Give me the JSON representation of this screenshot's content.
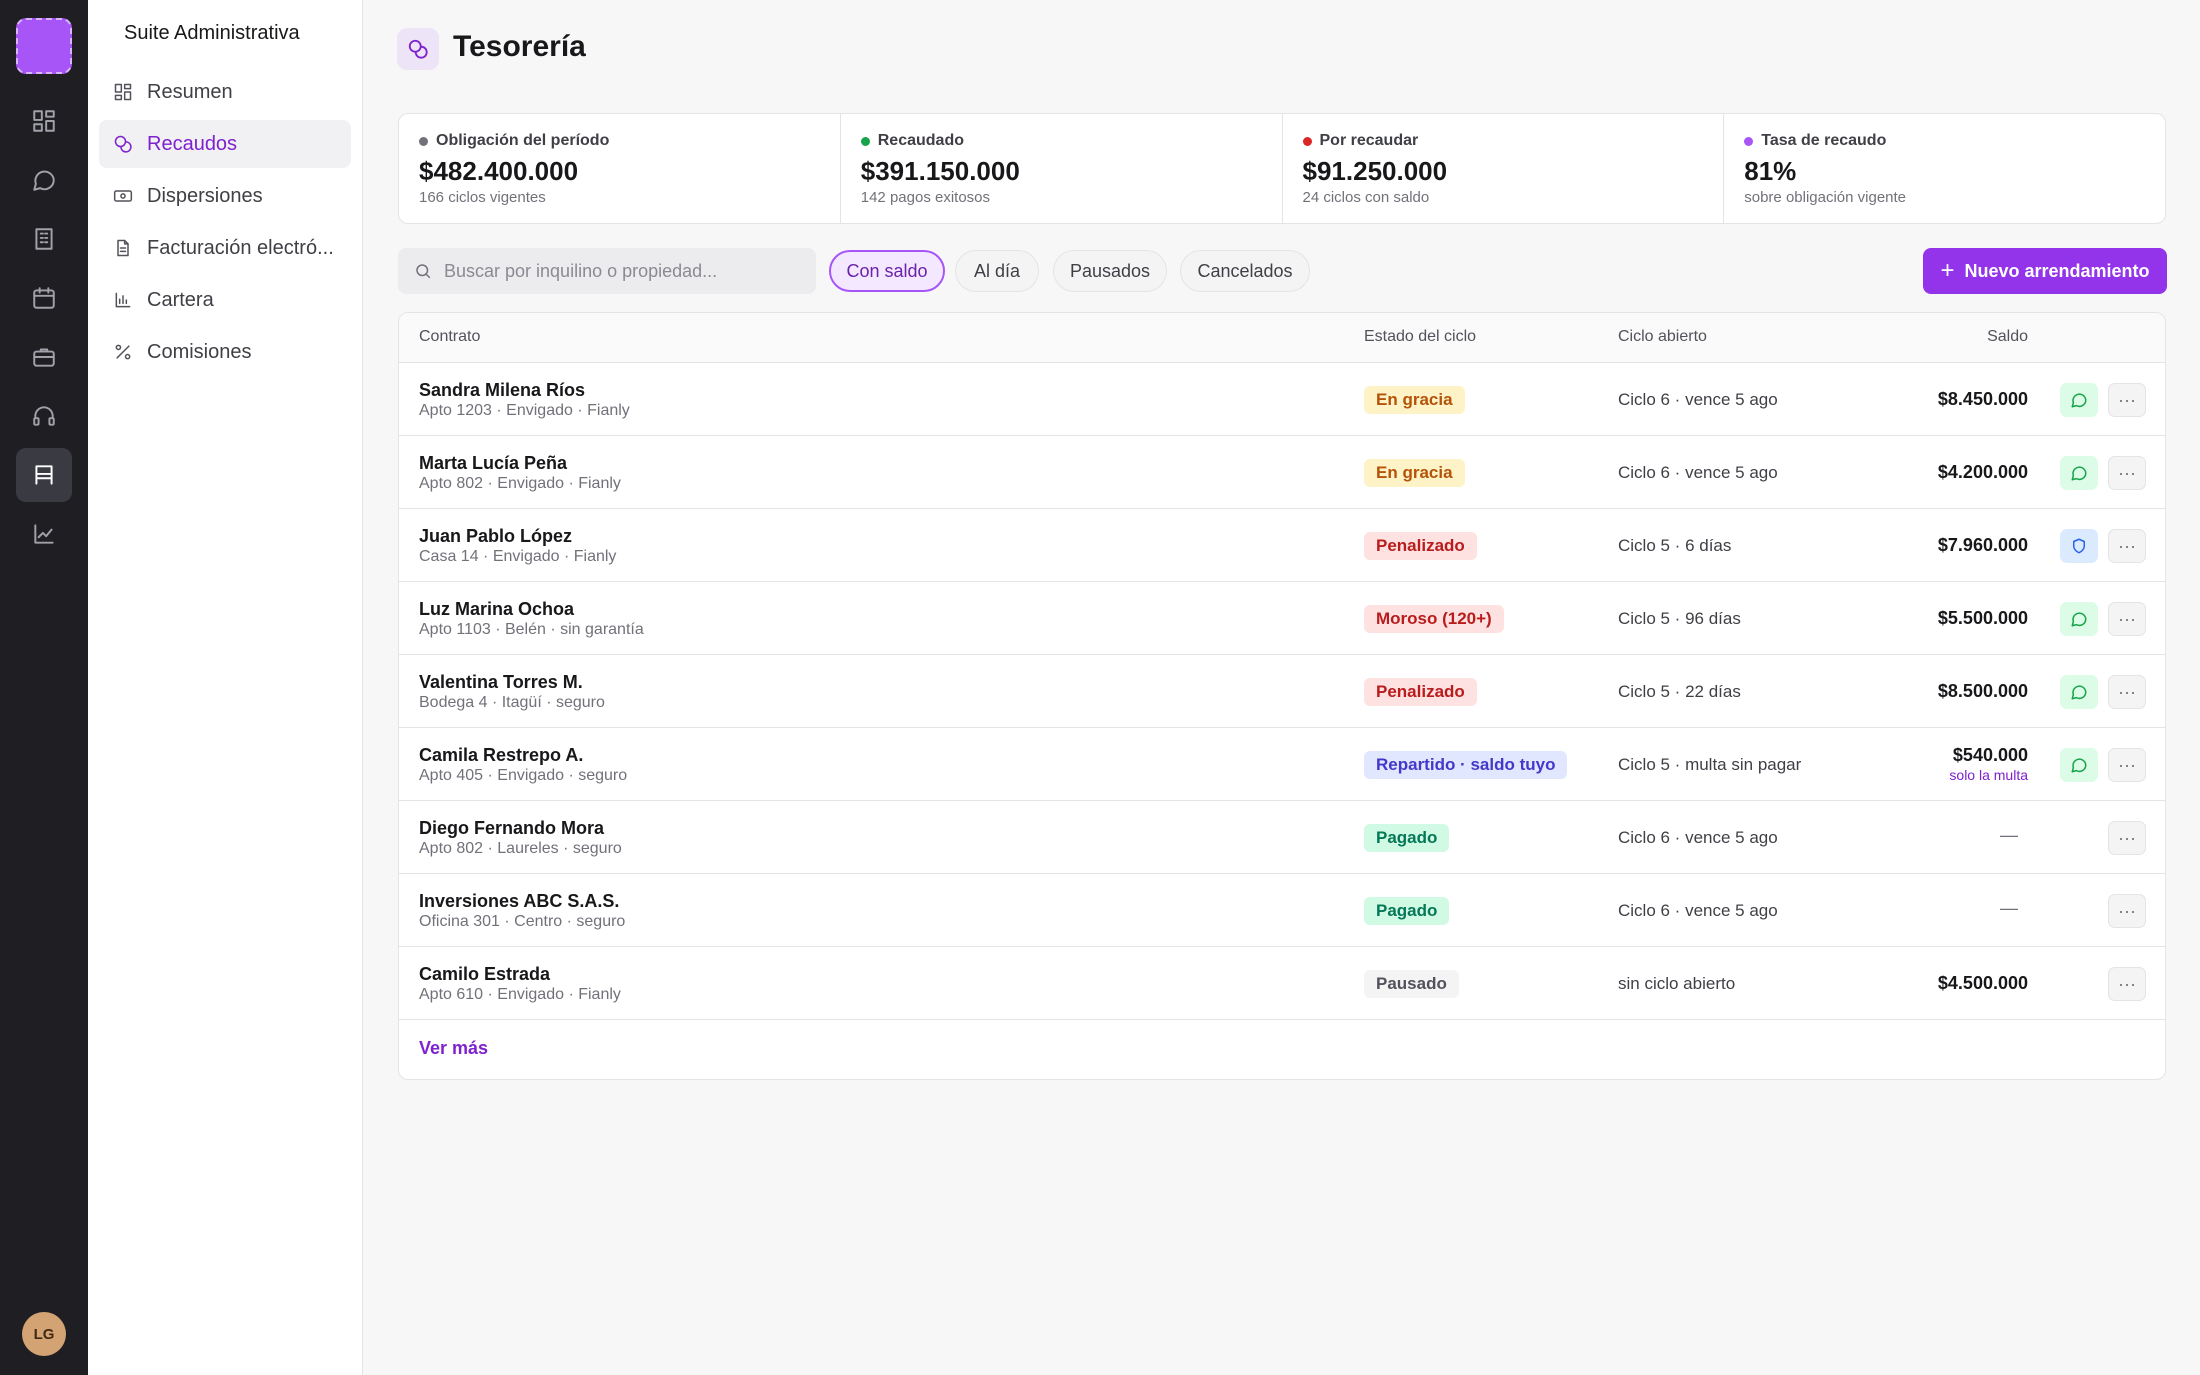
{
  "sidebar": {
    "suite_title": "Suite Administrativa",
    "items": [
      {
        "label": "Resumen",
        "icon": "layout-icon"
      },
      {
        "label": "Recaudos",
        "icon": "coins-icon",
        "active": true
      },
      {
        "label": "Dispersiones",
        "icon": "banknote-icon"
      },
      {
        "label": "Facturación electró...",
        "icon": "document-icon"
      },
      {
        "label": "Cartera",
        "icon": "bar-chart-icon"
      },
      {
        "label": "Comisiones",
        "icon": "percent-icon"
      }
    ]
  },
  "rail": {
    "icons": [
      "dashboard-icon",
      "chat-icon",
      "building-icon",
      "calendar-icon",
      "briefcase-icon",
      "headset-icon",
      "store-icon",
      "chart-line-icon"
    ],
    "active": "store-icon",
    "avatar_initials": "LG"
  },
  "header": {
    "title": "Tesorería"
  },
  "kpis": [
    {
      "label": "Obligación del período",
      "value": "$482.400.000",
      "sub": "166 ciclos vigentes",
      "dot_color": "#71717a"
    },
    {
      "label": "Recaudado",
      "value": "$391.150.000",
      "sub": "142 pagos exitosos",
      "dot_color": "#16a34a"
    },
    {
      "label": "Por recaudar",
      "value": "$91.250.000",
      "sub": "24 ciclos con saldo",
      "dot_color": "#dc2626"
    },
    {
      "label": "Tasa de recaudo",
      "value": "81%",
      "sub": "sobre obligación vigente",
      "dot_color": "#a855f7"
    }
  ],
  "search": {
    "placeholder": "Buscar por inquilino o propiedad...",
    "value": ""
  },
  "filters": [
    {
      "label": "Con saldo",
      "active": true
    },
    {
      "label": "Al día"
    },
    {
      "label": "Pausados"
    },
    {
      "label": "Cancelados"
    }
  ],
  "new_button": {
    "label": "Nuevo arrendamiento"
  },
  "table": {
    "columns": {
      "contrato": "Contrato",
      "estado": "Estado del ciclo",
      "ciclo": "Ciclo abierto",
      "saldo": "Saldo"
    },
    "rows": [
      {
        "name": "Sandra Milena Ríos",
        "meta": "Apto 1203 · Envigado · Fianly",
        "estado": "En gracia",
        "tone": "warn",
        "ciclo": "Ciclo 6 · vence 5 ago",
        "saldo": "$8.450.000",
        "action": "chat"
      },
      {
        "name": "Marta Lucía Peña",
        "meta": "Apto 802 · Envigado · Fianly",
        "estado": "En gracia",
        "tone": "warn",
        "ciclo": "Ciclo 6 · vence 5 ago",
        "saldo": "$4.200.000",
        "action": "chat"
      },
      {
        "name": "Juan Pablo López",
        "meta": "Casa 14 · Envigado · Fianly",
        "estado": "Penalizado",
        "tone": "danger",
        "ciclo": "Ciclo 5 · 6 días",
        "saldo": "$7.960.000",
        "action": "shield"
      },
      {
        "name": "Luz Marina Ochoa",
        "meta": "Apto 1103 · Belén · sin garantía",
        "estado": "Moroso (120+)",
        "tone": "danger",
        "ciclo": "Ciclo 5 · 96 días",
        "saldo": "$5.500.000",
        "action": "chat"
      },
      {
        "name": "Valentina Torres M.",
        "meta": "Bodega 4 · Itagüí · seguro",
        "estado": "Penalizado",
        "tone": "danger",
        "ciclo": "Ciclo 5 · 22 días",
        "saldo": "$8.500.000",
        "action": "chat"
      },
      {
        "name": "Camila Restrepo A.",
        "meta": "Apto 405 · Envigado · seguro",
        "estado": "Repartido · saldo tuyo",
        "tone": "purple",
        "ciclo": "Ciclo 5 · multa sin pagar",
        "saldo": "$540.000",
        "saldo_note": "solo la multa",
        "action": "chat"
      },
      {
        "name": "Diego Fernando Mora",
        "meta": "Apto 802 · Laureles · seguro",
        "estado": "Pagado",
        "tone": "ok",
        "ciclo": "Ciclo 6 · vence 5 ago",
        "saldo": "—",
        "action": "none"
      },
      {
        "name": "Inversiones ABC S.A.S.",
        "meta": "Oficina 301 · Centro · seguro",
        "estado": "Pagado",
        "tone": "ok",
        "ciclo": "Ciclo 6 · vence 5 ago",
        "saldo": "—",
        "action": "none"
      },
      {
        "name": "Camilo Estrada",
        "meta": "Apto 610 · Envigado · Fianly",
        "estado": "Pausado",
        "tone": "neutral",
        "ciclo": "sin ciclo abierto",
        "saldo": "$4.500.000",
        "action": "none"
      }
    ],
    "more_label": "Ver más"
  },
  "colors": {
    "accent": "#9333ea",
    "warn_bg": "#fef3c7",
    "warn_fg": "#b45309",
    "danger_bg": "#fee2e2",
    "danger_fg": "#b91c1c",
    "purple_bg": "#e0e7ff",
    "purple_fg": "#4338ca",
    "ok_bg": "#d1fae5",
    "ok_fg": "#047857",
    "neutral_bg": "#f4f4f5",
    "neutral_fg": "#52525b"
  }
}
